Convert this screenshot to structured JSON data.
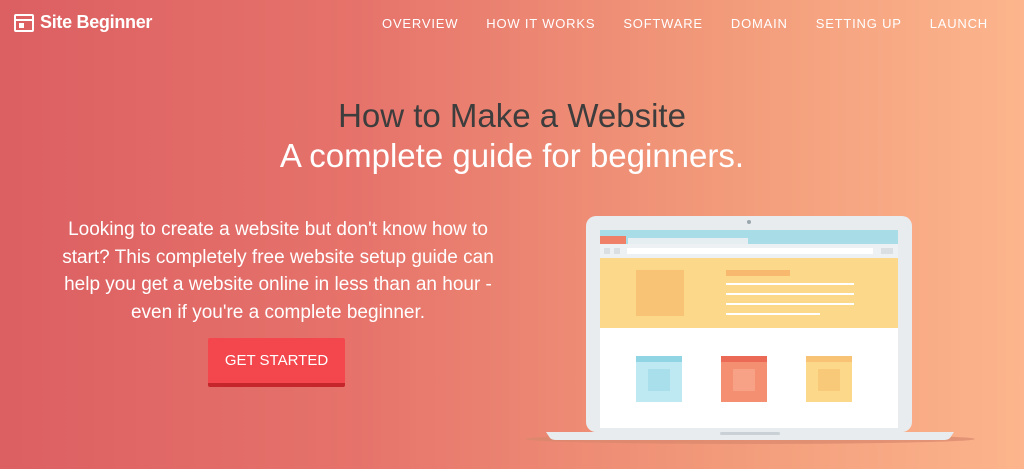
{
  "brand": {
    "name": "Site Beginner",
    "icon": "browser-window-icon"
  },
  "nav": [
    {
      "label": "OVERVIEW"
    },
    {
      "label": "HOW IT WORKS"
    },
    {
      "label": "SOFTWARE"
    },
    {
      "label": "DOMAIN"
    },
    {
      "label": "SETTING UP"
    },
    {
      "label": "LAUNCH"
    }
  ],
  "hero": {
    "title_line1": "How to Make a Website",
    "title_line2": "A complete guide for beginners.",
    "intro": "Looking to create a website but don't know how to start? This completely free website setup guide can help you get a website online in less than an hour - even if you're a complete beginner.",
    "cta_label": "GET STARTED"
  },
  "colors": {
    "gradient_start": "#dc5f62",
    "gradient_end": "#fcb58c",
    "title_dark": "#3d3d3d",
    "cta": "#f3474d"
  }
}
